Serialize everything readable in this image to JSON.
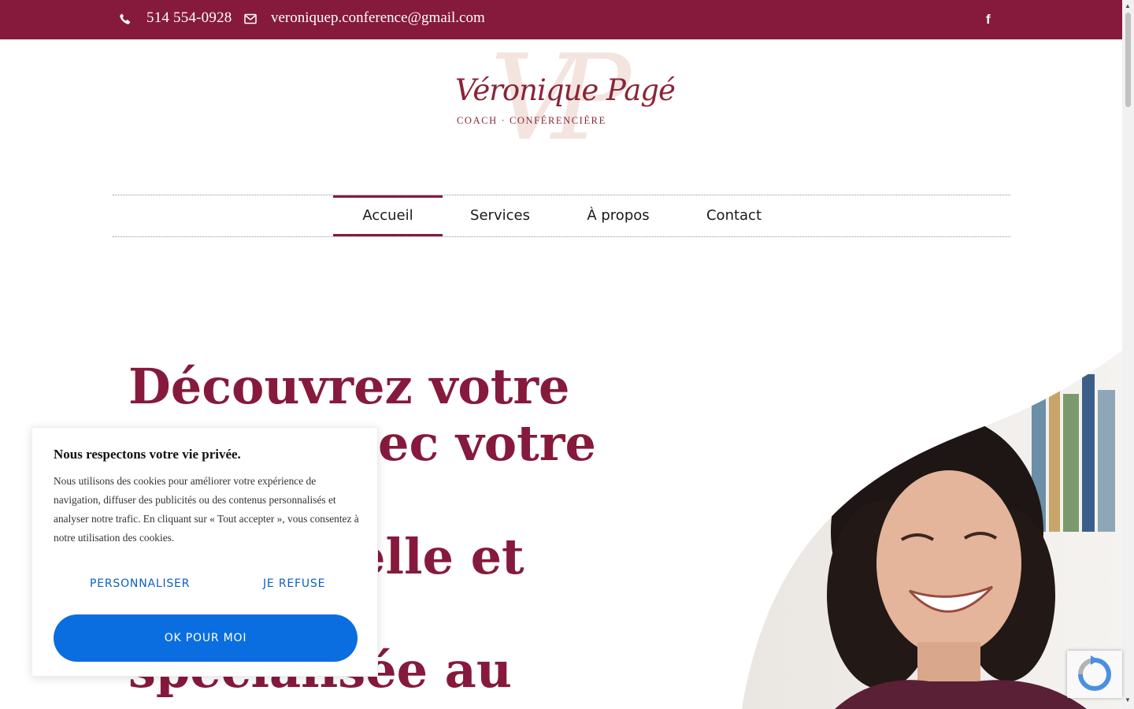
{
  "topbar": {
    "phone": "514 554-0928",
    "email": "veroniquep.conference@gmail.com",
    "phone_icon": "phone-icon",
    "mail_icon": "envelope-icon",
    "social_icon": "facebook-icon",
    "background": "#861a3c"
  },
  "logo": {
    "monogram": "VP",
    "name": "Véronique Pagé",
    "tagline": "COACH · CONFÉRENCIÈRE"
  },
  "nav": {
    "items": [
      {
        "label": "Accueil",
        "active": true
      },
      {
        "label": "Services",
        "active": false
      },
      {
        "label": "À propos",
        "active": false
      },
      {
        "label": "Contact",
        "active": false
      }
    ],
    "accent": "#861a3c"
  },
  "hero": {
    "lines": [
      "Découvrez votre",
      "",
      "",
      "",
      ""
    ],
    "visible_fragments": [
      "ec votre",
      "elle et",
      "spécialisée au"
    ]
  },
  "cookie": {
    "title": "Nous respectons votre vie privée.",
    "body": "Nous utilisons des cookies pour améliorer votre expérience de navigation, diffuser des publicités ou des contenus personnalisés et analyser notre trafic. En cliquant sur « Tout accepter », vous consentez à notre utilisation des cookies.",
    "customize_label": "PERSONNALISER",
    "refuse_label": "JE REFUSE",
    "accept_label": "OK POUR MOI",
    "accent": "#0a6ee0"
  },
  "recaptcha": {
    "icon": "recaptcha-icon"
  }
}
